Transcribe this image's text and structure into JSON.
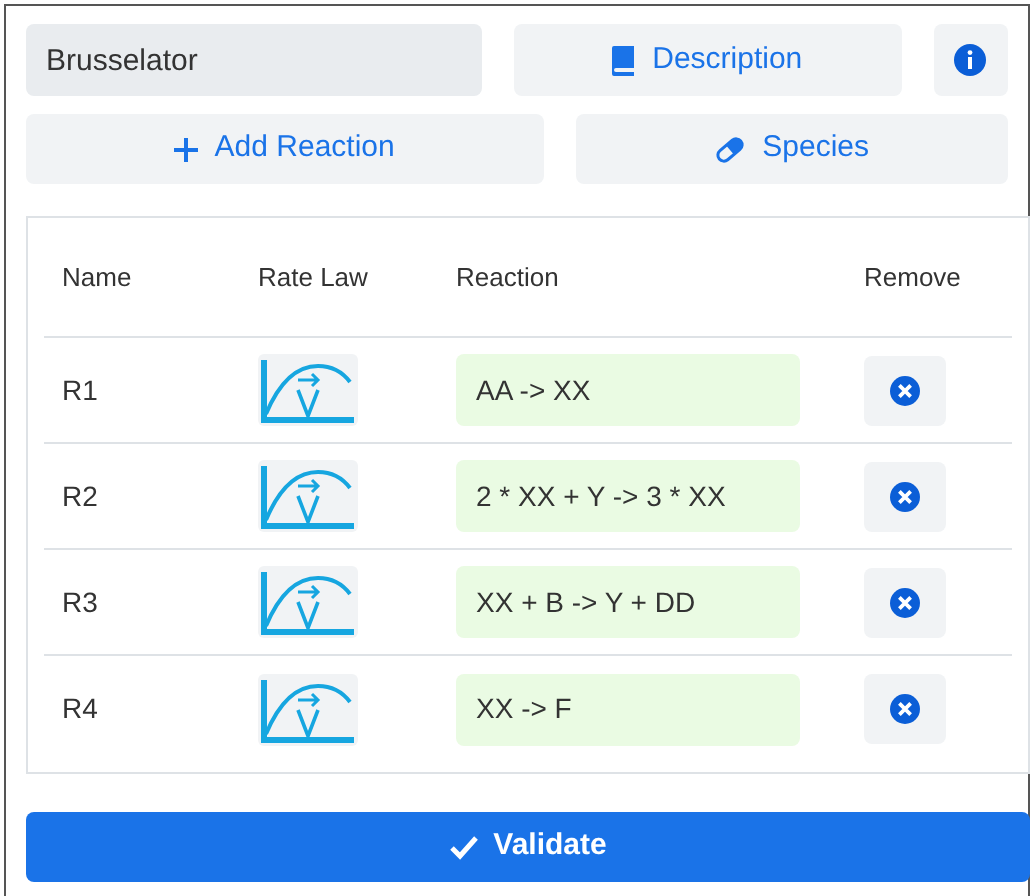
{
  "model_name": {
    "value": "Brusselator"
  },
  "buttons": {
    "description": "Description",
    "add_reaction": "Add Reaction",
    "species": "Species",
    "validate": "Validate"
  },
  "table": {
    "columns": [
      "Name",
      "Rate Law",
      "Reaction",
      "Remove"
    ],
    "rows": [
      {
        "name": "R1",
        "reaction": "AA -> XX"
      },
      {
        "name": "R2",
        "reaction": "2 * XX + Y -> 3 * XX"
      },
      {
        "name": "R3",
        "reaction": "XX + B -> Y + DD"
      },
      {
        "name": "R4",
        "reaction": "XX -> F"
      }
    ]
  }
}
